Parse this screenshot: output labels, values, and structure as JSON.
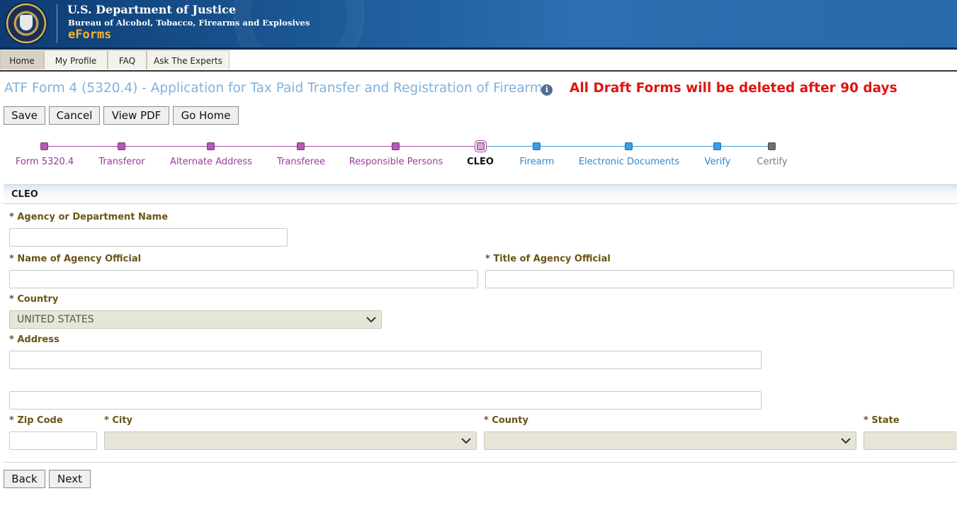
{
  "header": {
    "department": "U.S. Department of Justice",
    "bureau": "Bureau of Alcohol, Tobacco, Firearms and Explosives",
    "app_name": "eForms"
  },
  "tabs": [
    {
      "label": "Home",
      "active": true
    },
    {
      "label": "My Profile",
      "active": false
    },
    {
      "label": "FAQ",
      "active": false
    },
    {
      "label": "Ask The Experts",
      "active": false
    }
  ],
  "page": {
    "title": "ATF Form 4 (5320.4) - Application for Tax Paid Transfer and Registration of Firearm",
    "info_icon": "info-icon",
    "warning": "All Draft Forms will be deleted after 90 days"
  },
  "toolbar": {
    "save": "Save",
    "cancel": "Cancel",
    "view_pdf": "View PDF",
    "go_home": "Go Home"
  },
  "steps": [
    {
      "label": "Form 5320.4",
      "state": "done"
    },
    {
      "label": "Transferor",
      "state": "done"
    },
    {
      "label": "Alternate Address",
      "state": "done"
    },
    {
      "label": "Transferee",
      "state": "done"
    },
    {
      "label": "Responsible Persons",
      "state": "done"
    },
    {
      "label": "CLEO",
      "state": "current"
    },
    {
      "label": "Firearm",
      "state": "future"
    },
    {
      "label": "Electronic Documents",
      "state": "future"
    },
    {
      "label": "Verify",
      "state": "future"
    },
    {
      "label": "Certify",
      "state": "disabled"
    }
  ],
  "section": {
    "title": "CLEO",
    "fields": {
      "agency_name": {
        "label": "* Agency or Department Name",
        "value": ""
      },
      "official_name": {
        "label": "* Name of Agency Official",
        "value": ""
      },
      "official_title": {
        "label": "* Title of Agency Official",
        "value": ""
      },
      "country": {
        "label": "* Country",
        "value": "UNITED STATES"
      },
      "address": {
        "label": "* Address",
        "line1": "",
        "line2": ""
      },
      "zip": {
        "label": "* Zip Code",
        "value": ""
      },
      "city": {
        "label": "* City",
        "value": ""
      },
      "county": {
        "label": "* County",
        "value": ""
      },
      "state": {
        "label": "* State",
        "value": ""
      }
    }
  },
  "nav": {
    "back": "Back",
    "next": "Next"
  },
  "colors": {
    "step_done": "#b55bb4",
    "step_future": "#3b9ee6",
    "step_disabled": "#6f6f6f",
    "title": "#7fb2de",
    "warning": "#e0140f",
    "label": "#6b5417"
  }
}
